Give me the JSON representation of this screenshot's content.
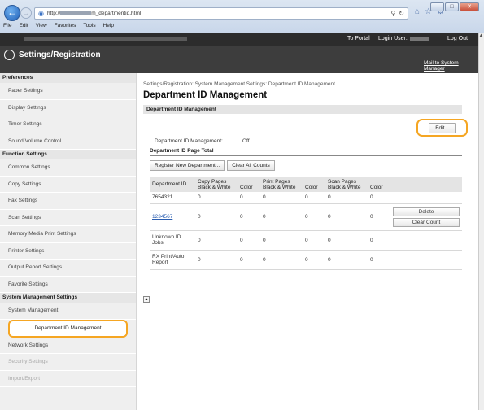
{
  "browser": {
    "address": {
      "prefix": "http://",
      "suffix": "m_departmentid.html"
    },
    "menu": [
      "File",
      "Edit",
      "View",
      "Favorites",
      "Tools",
      "Help"
    ],
    "window_controls": [
      "–",
      "□",
      "✕"
    ]
  },
  "header": {
    "app_title": "Settings/Registration",
    "to_portal": "To Portal",
    "login_user_label": "Login User:",
    "logout": "Log Out",
    "mail_manager": "Mail to System Manager"
  },
  "sidebar": {
    "sections": [
      {
        "title": "Preferences",
        "items": [
          {
            "label": "Paper Settings"
          },
          {
            "label": "Display Settings"
          },
          {
            "label": "Timer Settings"
          },
          {
            "label": "Sound Volume Control"
          }
        ]
      },
      {
        "title": "Function Settings",
        "items": [
          {
            "label": "Common Settings"
          },
          {
            "label": "Copy Settings"
          },
          {
            "label": "Fax Settings"
          },
          {
            "label": "Scan Settings"
          },
          {
            "label": "Memory Media Print Settings"
          },
          {
            "label": "Printer Settings"
          },
          {
            "label": "Output Report Settings"
          },
          {
            "label": "Favorite Settings"
          }
        ]
      },
      {
        "title": "System Management Settings",
        "items": [
          {
            "label": "System Management"
          },
          {
            "label": "Department ID Management",
            "active": true
          },
          {
            "label": "Network Settings"
          },
          {
            "label": "Security Settings"
          },
          {
            "label": "Import/Export"
          }
        ]
      }
    ]
  },
  "main": {
    "breadcrumb": "Settings/Registration: System Management Settings: Department ID Management",
    "title": "Department ID Management",
    "section_title": "Department ID Management",
    "edit_label": "Edit...",
    "status_label": "Department ID Management:",
    "status_value": "Off",
    "page_total_label": "Department ID Page Total",
    "register_button": "Register New Department...",
    "clear_all_button": "Clear All Counts",
    "table": {
      "headers": {
        "dept_id": "Department ID",
        "copy_pages": "Copy Pages",
        "print_pages": "Print Pages",
        "scan_pages": "Scan Pages",
        "black_white": "Black & White",
        "color": "Color"
      },
      "rows": [
        {
          "id": "7654321",
          "link": false,
          "values": [
            "0",
            "0",
            "0",
            "0",
            "0",
            "0"
          ],
          "buttons": []
        },
        {
          "id": "1234567",
          "link": true,
          "values": [
            "0",
            "0",
            "0",
            "0",
            "0",
            "0"
          ],
          "buttons": [
            "Delete",
            "Clear Count"
          ]
        },
        {
          "id": "Unknown ID Jobs",
          "link": false,
          "values": [
            "0",
            "0",
            "0",
            "0",
            "0",
            "0"
          ],
          "buttons": []
        },
        {
          "id": "RX Print/Auto Report",
          "link": false,
          "values": [
            "0",
            "0",
            "0",
            "0",
            "0",
            "0"
          ],
          "buttons": []
        }
      ]
    }
  },
  "colors": {
    "header_bg": "#3d3d3d",
    "highlight": "#f5a623",
    "link": "#2a5db0"
  }
}
